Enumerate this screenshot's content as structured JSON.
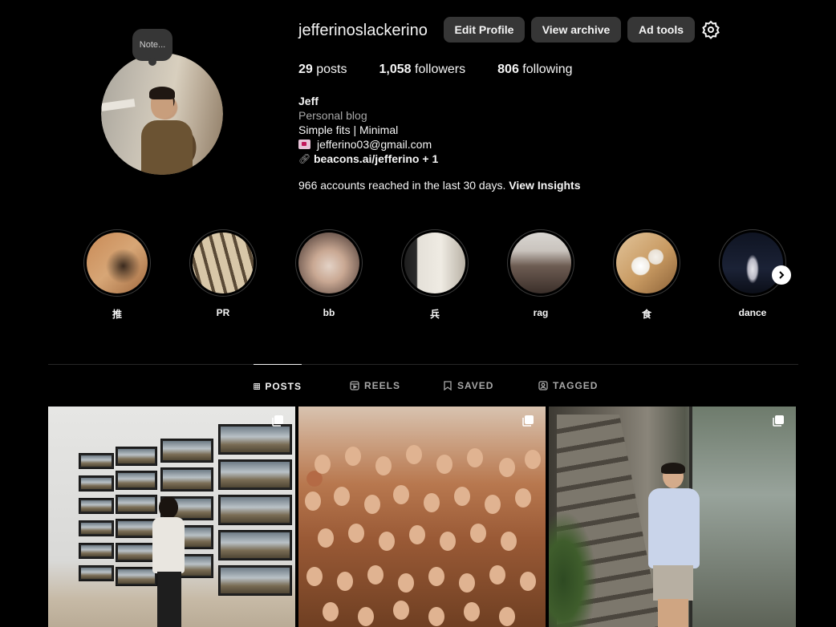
{
  "profile": {
    "note": "Note...",
    "username": "jefferinoslackerino",
    "buttons": {
      "edit": "Edit Profile",
      "archive": "View archive",
      "ad_tools": "Ad tools"
    },
    "stats": {
      "posts_count": "29",
      "posts_label": "posts",
      "followers_count": "1,058",
      "followers_label": "followers",
      "following_count": "806",
      "following_label": "following"
    },
    "bio": {
      "name": "Jeff",
      "category": "Personal blog",
      "line1": "Simple fits | Minimal",
      "email": "jefferino03@gmail.com",
      "link": "beacons.ai/jefferino + 1"
    },
    "insights": {
      "text": "966 accounts reached in the last 30 days.",
      "link": "View Insights"
    }
  },
  "highlights": [
    {
      "label": "推"
    },
    {
      "label": "PR"
    },
    {
      "label": "bb"
    },
    {
      "label": "兵"
    },
    {
      "label": "rag"
    },
    {
      "label": "食"
    },
    {
      "label": "dance"
    }
  ],
  "tabs": {
    "posts": "POSTS",
    "reels": "REELS",
    "saved": "SAVED",
    "tagged": "TAGGED"
  },
  "colors": {
    "background": "#000000",
    "button": "#363636",
    "secondary_text": "#a8a8a8"
  }
}
